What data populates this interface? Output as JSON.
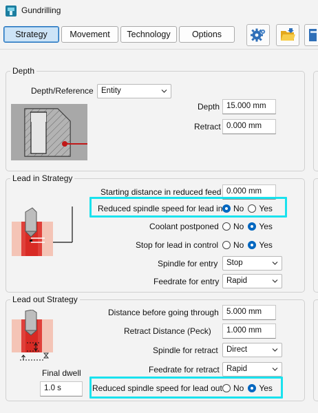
{
  "window": {
    "title": "Gundrilling"
  },
  "tabs": [
    {
      "label": "Strategy",
      "active": true
    },
    {
      "label": "Movement",
      "active": false
    },
    {
      "label": "Technology",
      "active": false
    },
    {
      "label": "Options",
      "active": false
    }
  ],
  "toolbar": {
    "icons": [
      "settings-gear-icon",
      "open-folder-icon",
      "book-icon"
    ]
  },
  "depth_group": {
    "legend": "Depth",
    "depth_reference": {
      "label": "Depth/Reference",
      "value": "Entity"
    },
    "depth": {
      "label": "Depth",
      "value": "15.000 mm"
    },
    "retract": {
      "label": "Retract",
      "value": "0.000 mm"
    }
  },
  "lead_in_group": {
    "legend": "Lead in Strategy",
    "starting_distance": {
      "label": "Starting distance in reduced feed",
      "value": "0.000 mm"
    },
    "reduced_spindle_speed": {
      "label": "Reduced spindle speed for lead in",
      "no": "No",
      "yes": "Yes",
      "selected": "No"
    },
    "coolant_postponed": {
      "label": "Coolant postponed",
      "no": "No",
      "yes": "Yes",
      "selected": "Yes"
    },
    "stop_for_lead_in": {
      "label": "Stop for lead in control",
      "no": "No",
      "yes": "Yes",
      "selected": "Yes"
    },
    "spindle_for_entry": {
      "label": "Spindle for entry",
      "value": "Stop"
    },
    "feedrate_for_entry": {
      "label": "Feedrate for entry",
      "value": "Rapid"
    }
  },
  "lead_out_group": {
    "legend": "Lead out Strategy",
    "distance_before": {
      "label": "Distance before going through",
      "value": "5.000 mm"
    },
    "retract_distance_peck": {
      "label": "Retract Distance (Peck)",
      "value": "1.000 mm"
    },
    "spindle_for_retract": {
      "label": "Spindle for retract",
      "value": "Direct"
    },
    "feedrate_for_retract": {
      "label": "Feedrate for retract",
      "value": "Rapid"
    },
    "final_dwell": {
      "label": "Final dwell",
      "value": "1.0 s"
    },
    "reduced_spindle_speed_out": {
      "label": "Reduced spindle speed for lead out",
      "no": "No",
      "yes": "Yes",
      "selected": "Yes"
    }
  },
  "colors": {
    "accent": "#0067c0",
    "highlight": "#19e2ee",
    "tool_red": "#e0403a"
  }
}
